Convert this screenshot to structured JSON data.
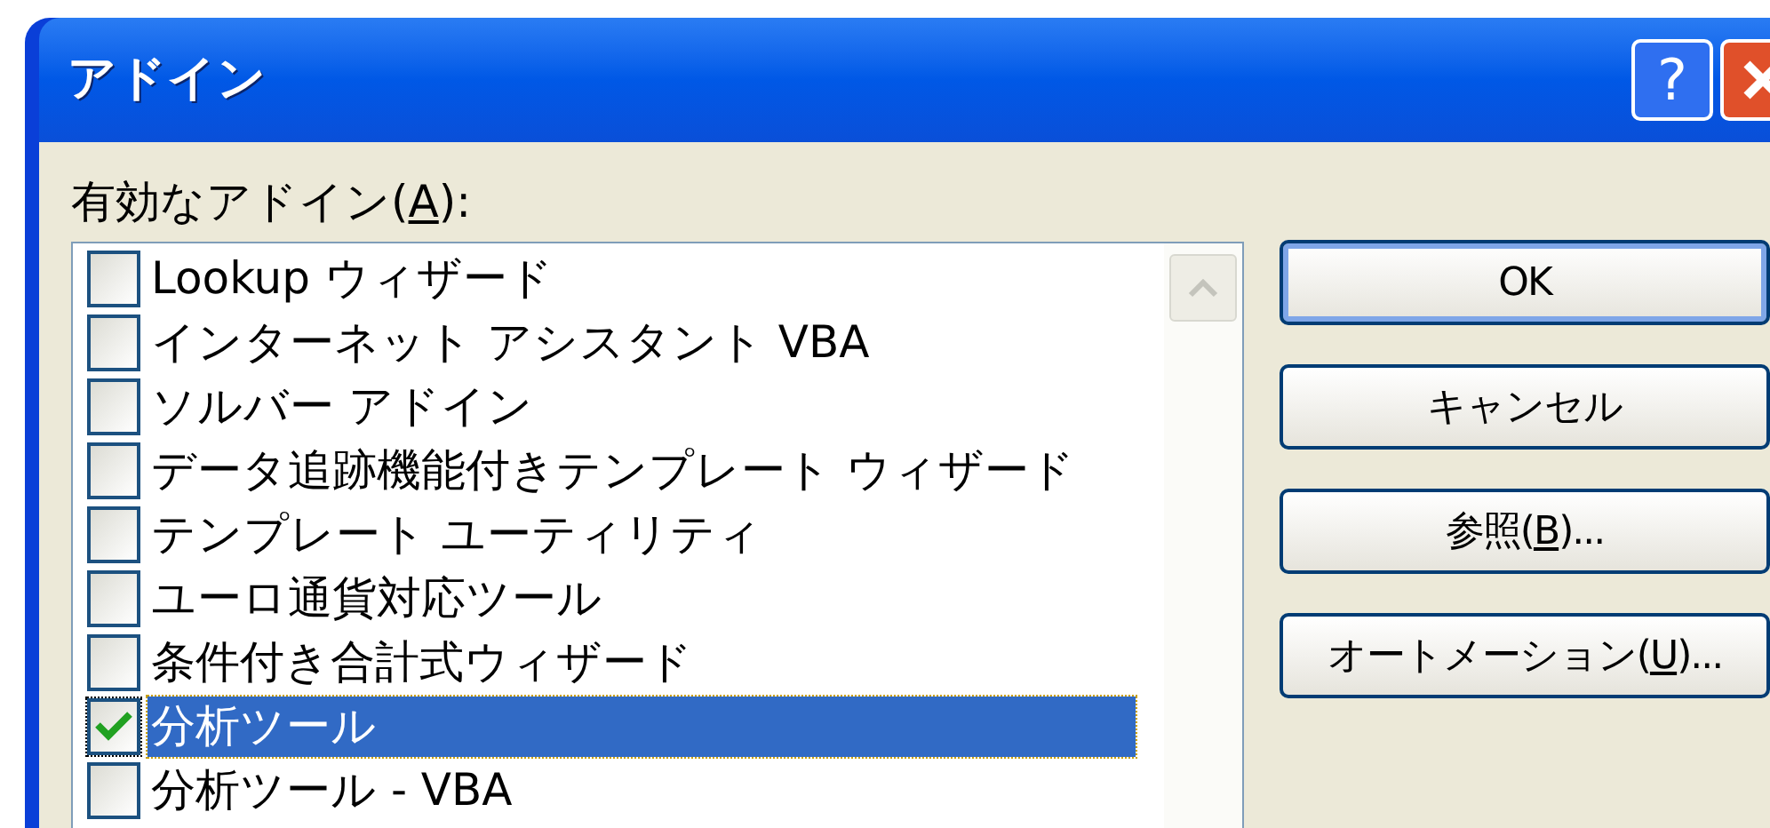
{
  "window": {
    "title": "アドイン",
    "help_button": "?"
  },
  "addins_label": [
    {
      "text": "有効なアドイン("
    },
    {
      "text": "A",
      "underlined": true
    },
    {
      "text": "):"
    }
  ],
  "addins": [
    {
      "label": "Lookup ウィザード",
      "checked": false,
      "selected": false
    },
    {
      "label": "インターネット アシスタント VBA",
      "checked": false,
      "selected": false
    },
    {
      "label": "ソルバー アドイン",
      "checked": false,
      "selected": false
    },
    {
      "label": "データ追跡機能付きテンプレート ウィザード",
      "checked": false,
      "selected": false
    },
    {
      "label": "テンプレート ユーティリティ",
      "checked": false,
      "selected": false
    },
    {
      "label": "ユーロ通貨対応ツール",
      "checked": false,
      "selected": false
    },
    {
      "label": "条件付き合計式ウィザード",
      "checked": false,
      "selected": false
    },
    {
      "label": "分析ツール",
      "checked": true,
      "selected": true
    },
    {
      "label": "分析ツール - VBA",
      "checked": false,
      "selected": false
    }
  ],
  "buttons": [
    {
      "parts": [
        {
          "text": "OK"
        }
      ],
      "default": true
    },
    {
      "parts": [
        {
          "text": "キャンセル"
        }
      ],
      "default": false
    },
    {
      "parts": [
        {
          "text": "参照("
        },
        {
          "text": "B",
          "underlined": true
        },
        {
          "text": ")..."
        }
      ],
      "default": false
    },
    {
      "parts": [
        {
          "text": "オートメーション("
        },
        {
          "text": "U",
          "underlined": true
        },
        {
          "text": ")..."
        }
      ],
      "default": false
    }
  ]
}
